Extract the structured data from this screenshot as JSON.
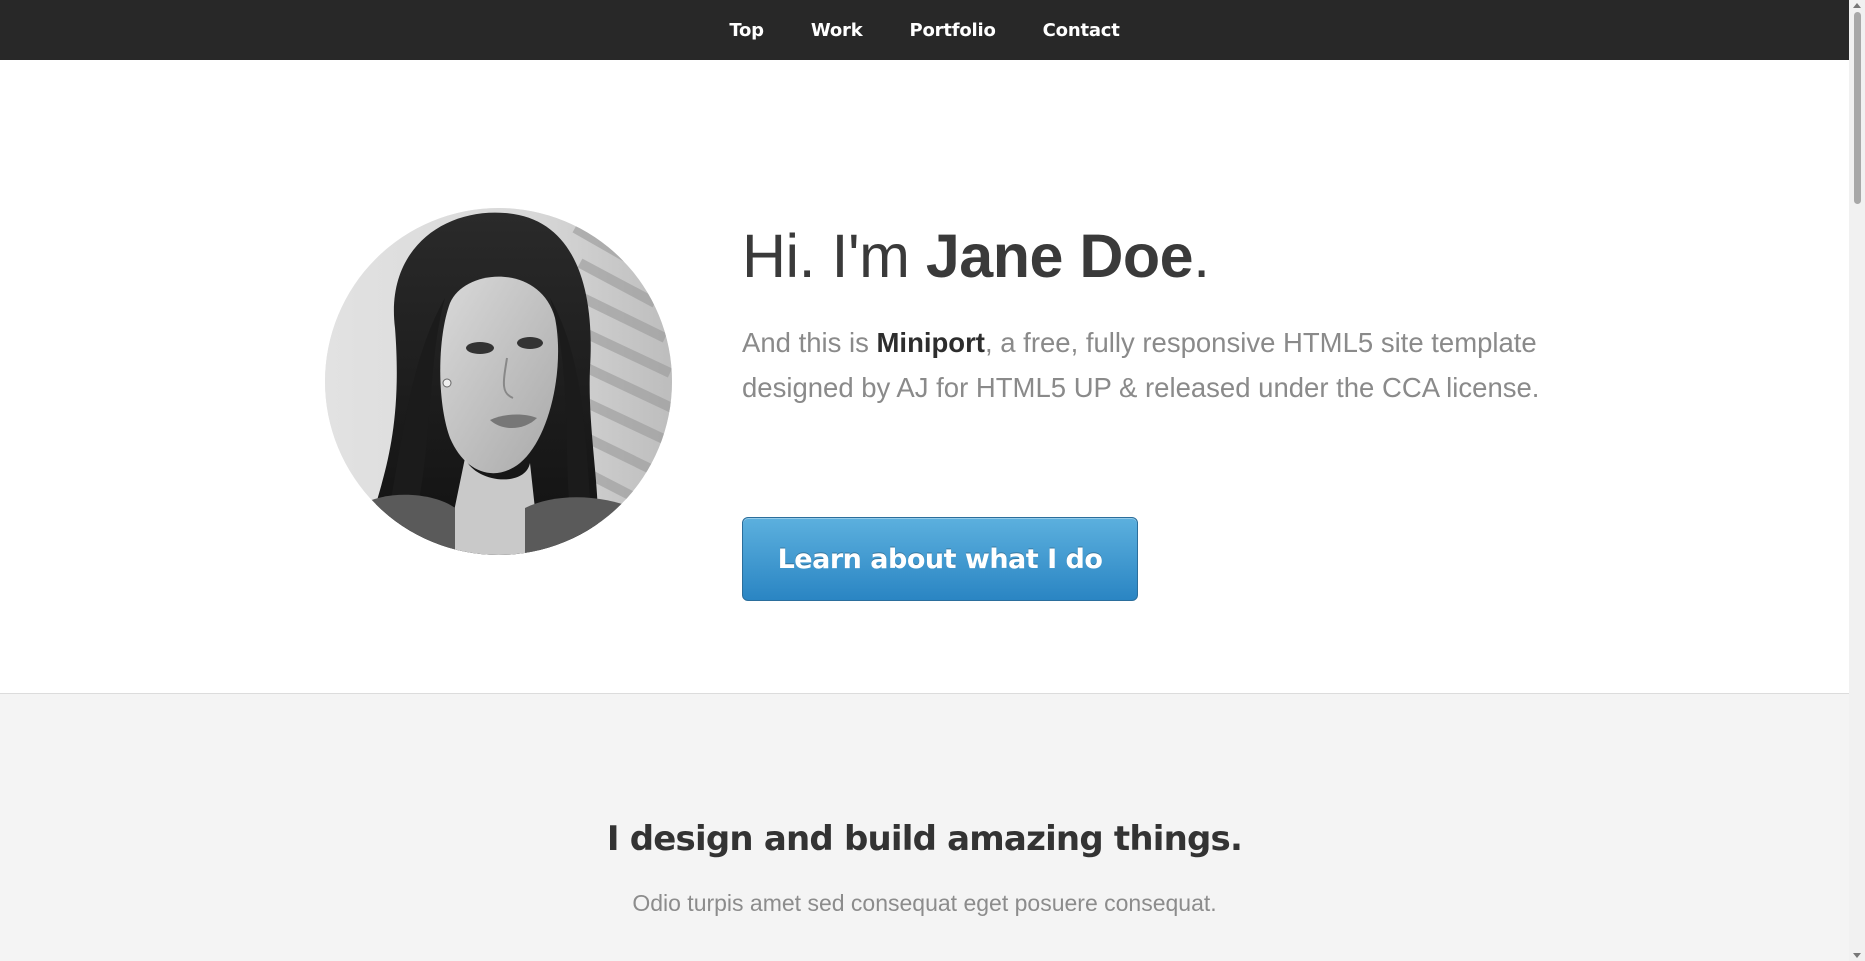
{
  "nav": {
    "items": [
      "Top",
      "Work",
      "Portfolio",
      "Contact"
    ]
  },
  "hero": {
    "greeting": "Hi. I'm ",
    "name": "Jane Doe",
    "period": ".",
    "desc_prefix": "And this is ",
    "brand": "Miniport",
    "desc_suffix": ", a free, fully responsive HTML5 site template designed by AJ for HTML5 UP & released under the CCA license.",
    "button_label": "Learn about what I do"
  },
  "work": {
    "title": "I design and build amazing things.",
    "subtitle": "Odio turpis amet sed consequat eget posuere consequat."
  },
  "colors": {
    "nav_bg": "#282828",
    "button_top": "#5cb0de",
    "button_bottom": "#2a85c3",
    "section_bg": "#f4f4f4"
  }
}
